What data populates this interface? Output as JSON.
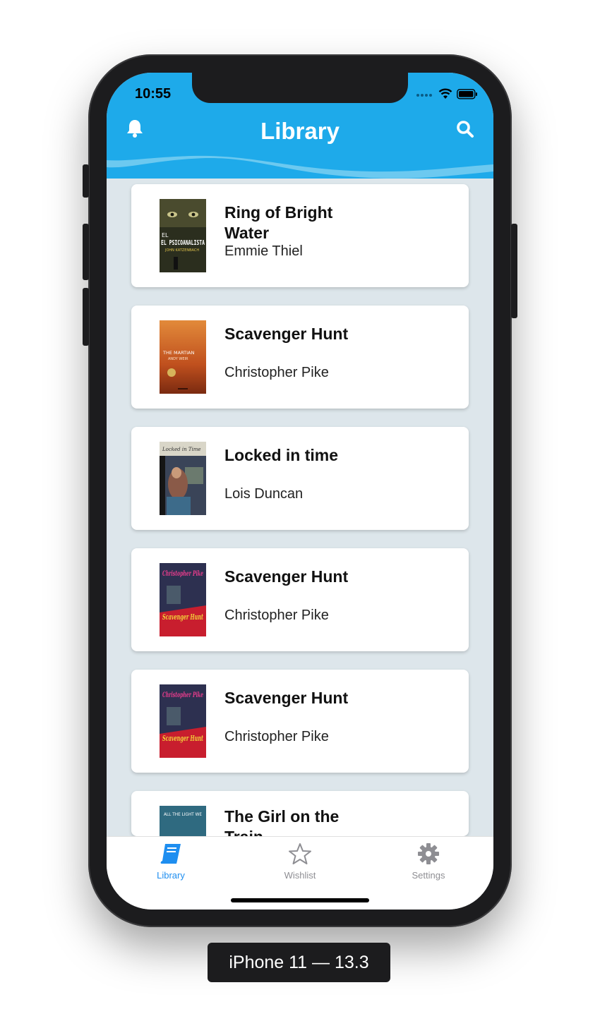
{
  "status_bar": {
    "time": "10:55"
  },
  "header": {
    "title": "Library"
  },
  "books": [
    {
      "title": "Ring of Bright Water",
      "author": "Emmie Thiel",
      "cover_text": "EL PSICOANALISTA",
      "cover_sub": "JOHN KATZENBACH"
    },
    {
      "title": "Scavenger Hunt",
      "author": "Christopher Pike",
      "cover_text": "THE MARTIAN",
      "cover_sub": "ANDY WEIR"
    },
    {
      "title": "Locked in time",
      "author": "Lois Duncan",
      "cover_text": "Locked in Time",
      "cover_sub": ""
    },
    {
      "title": "Scavenger Hunt",
      "author": "Christopher Pike",
      "cover_text": "Scavenger Hunt",
      "cover_sub": "Christopher Pike"
    },
    {
      "title": "Scavenger Hunt",
      "author": "Christopher Pike",
      "cover_text": "Scavenger Hunt",
      "cover_sub": "Christopher Pike"
    },
    {
      "title": "The Girl on the Train",
      "author": "",
      "cover_text": "ALL THE LIGHT WE",
      "cover_sub": ""
    }
  ],
  "tabs": [
    {
      "label": "Library",
      "icon": "book-icon",
      "active": true
    },
    {
      "label": "Wishlist",
      "icon": "star-icon",
      "active": false
    },
    {
      "label": "Settings",
      "icon": "gear-icon",
      "active": false
    }
  ],
  "device_caption": "iPhone 11 — 13.3",
  "colors": {
    "accent": "#1eaaea",
    "background": "#dde6eb",
    "inactive_tab": "#8e8e93"
  }
}
